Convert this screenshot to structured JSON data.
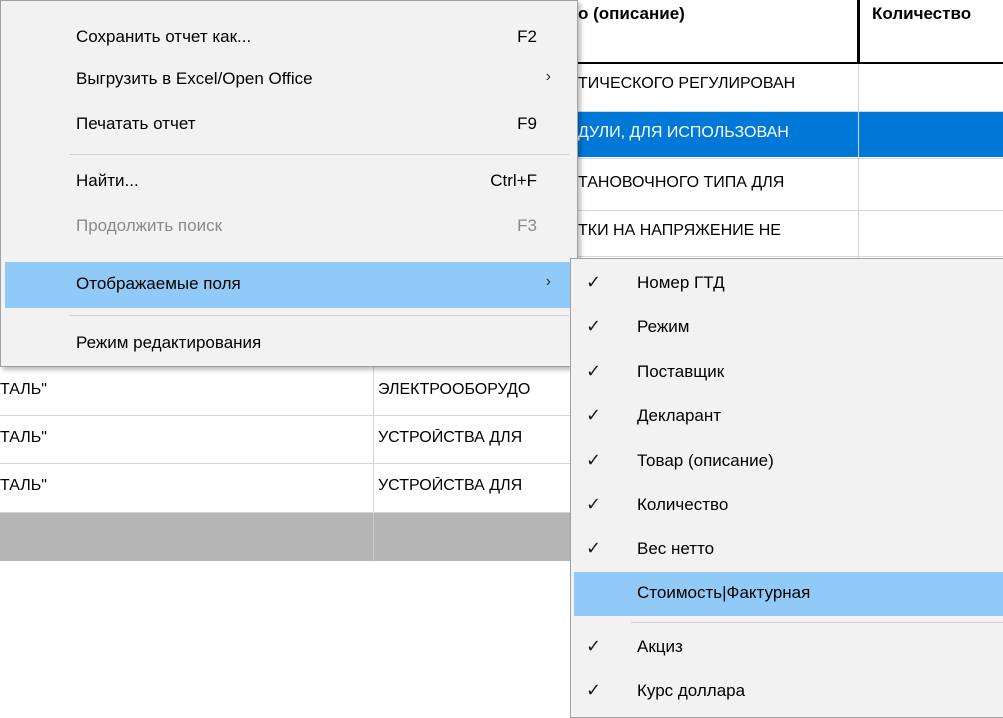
{
  "grid": {
    "headers": {
      "description": "о (описание)",
      "quantity": "Количество"
    },
    "rows_right": [
      "ТИЧЕСКОГО РЕГУЛИРОВАН",
      "ДУЛИ, ДЛЯ ИСПОЛЬЗОВАН",
      "ТАНОВОЧНОГО ТИПА  ДЛЯ",
      "ТКИ НА НАПРЯЖЕНИЕ НЕ"
    ],
    "rows_left": [
      {
        "supplier": "ТАЛЬ\"",
        "goods": "ЭЛЕКТРООБОРУДО"
      },
      {
        "supplier": "ТАЛЬ\"",
        "goods": "УСТРОЙСТВА ДЛЯ"
      },
      {
        "supplier": "ТАЛЬ\"",
        "goods": "УСТРОЙСТВА ДЛЯ"
      }
    ]
  },
  "menu": {
    "items": [
      {
        "label": "Сохранить отчет как...",
        "shortcut": "F2"
      },
      {
        "label": "Выгрузить в Excel/Open Office",
        "arrow": "›"
      },
      {
        "label": "Печатать отчет",
        "shortcut": "F9"
      },
      {
        "label": "Найти...",
        "shortcut": "Ctrl+F"
      },
      {
        "label": "Продолжить поиск",
        "shortcut": "F3"
      },
      {
        "label": "Отображаемые поля",
        "arrow": "›"
      },
      {
        "label": "Режим редактирования"
      }
    ]
  },
  "submenu": {
    "check_glyph": "✓",
    "items": [
      {
        "label": "Номер ГТД",
        "checked": true
      },
      {
        "label": "Режим",
        "checked": true
      },
      {
        "label": "Поставщик",
        "checked": true
      },
      {
        "label": "Декларант",
        "checked": true
      },
      {
        "label": "Товар (описание)",
        "checked": true
      },
      {
        "label": "Количество",
        "checked": true
      },
      {
        "label": "Вес нетто",
        "checked": true
      },
      {
        "label": "Стоимость|Фактурная",
        "checked": false
      },
      {
        "label": "Акциз",
        "checked": true
      },
      {
        "label": "Курс доллара",
        "checked": true
      }
    ]
  },
  "colors": {
    "selection": "#0078d7",
    "menu_highlight": "#91c9f7",
    "menu_bg": "#f2f2f2"
  }
}
